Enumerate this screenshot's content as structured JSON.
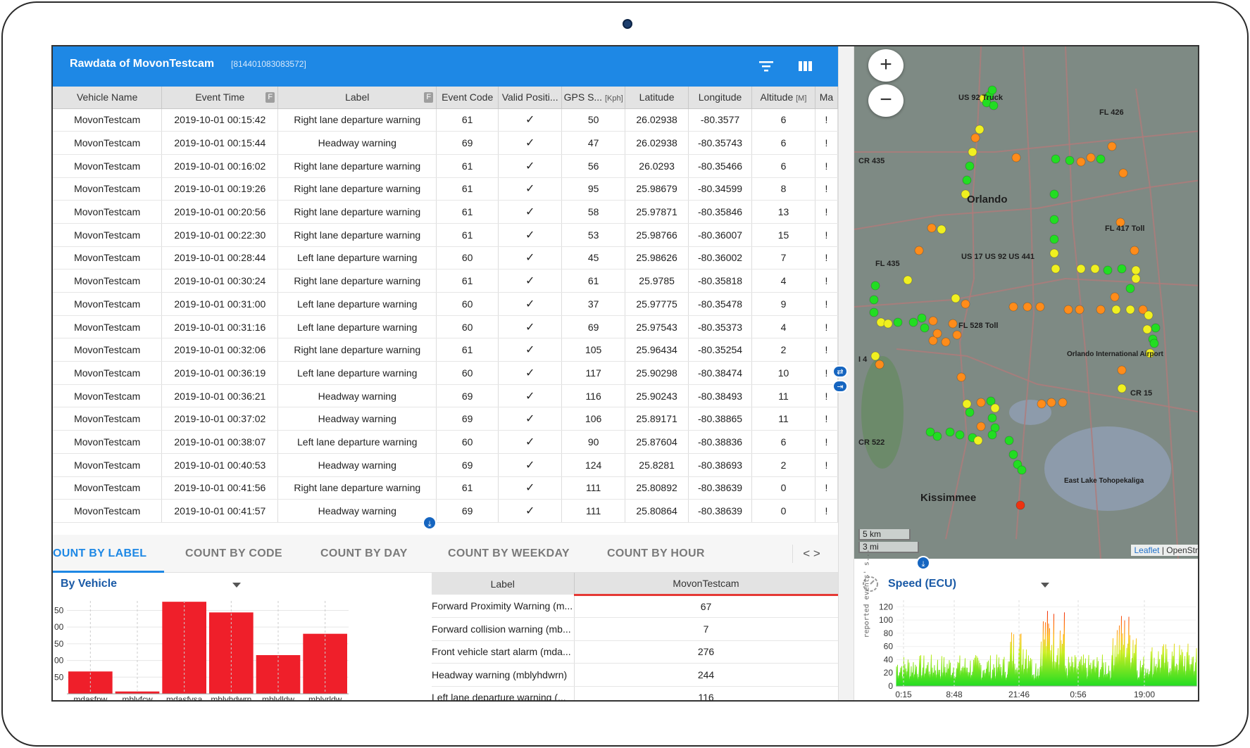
{
  "header": {
    "title": "Rawdata of MovonTestcam",
    "subtitle": "[814401083083572]"
  },
  "table": {
    "columns": [
      "Vehicle Name",
      "Event Time",
      "Label",
      "Event Code",
      "Valid Positi...",
      "GPS S...",
      "Latitude",
      "Longitude",
      "Altitude",
      "Ma"
    ],
    "units": {
      "gps": "[Kph]",
      "altitude": "[M]"
    },
    "filter_badge": "F",
    "rows": [
      [
        "MovonTestcam",
        "2019-10-01 00:15:42",
        "Right lane departure warning",
        "61",
        "✓",
        "50",
        "26.02938",
        "-80.3577",
        "6",
        "!"
      ],
      [
        "MovonTestcam",
        "2019-10-01 00:15:44",
        "Headway warning",
        "69",
        "✓",
        "47",
        "26.02938",
        "-80.35743",
        "6",
        "!"
      ],
      [
        "MovonTestcam",
        "2019-10-01 00:16:02",
        "Right lane departure warning",
        "61",
        "✓",
        "56",
        "26.0293",
        "-80.35466",
        "6",
        "!"
      ],
      [
        "MovonTestcam",
        "2019-10-01 00:19:26",
        "Right lane departure warning",
        "61",
        "✓",
        "95",
        "25.98679",
        "-80.34599",
        "8",
        "!"
      ],
      [
        "MovonTestcam",
        "2019-10-01 00:20:56",
        "Right lane departure warning",
        "61",
        "✓",
        "58",
        "25.97871",
        "-80.35846",
        "13",
        "!"
      ],
      [
        "MovonTestcam",
        "2019-10-01 00:22:30",
        "Right lane departure warning",
        "61",
        "✓",
        "53",
        "25.98766",
        "-80.36007",
        "15",
        "!"
      ],
      [
        "MovonTestcam",
        "2019-10-01 00:28:44",
        "Left lane departure warning",
        "60",
        "✓",
        "45",
        "25.98626",
        "-80.36002",
        "7",
        "!"
      ],
      [
        "MovonTestcam",
        "2019-10-01 00:30:24",
        "Right lane departure warning",
        "61",
        "✓",
        "61",
        "25.9785",
        "-80.35818",
        "4",
        "!"
      ],
      [
        "MovonTestcam",
        "2019-10-01 00:31:00",
        "Left lane departure warning",
        "60",
        "✓",
        "37",
        "25.97775",
        "-80.35478",
        "9",
        "!"
      ],
      [
        "MovonTestcam",
        "2019-10-01 00:31:16",
        "Left lane departure warning",
        "60",
        "✓",
        "69",
        "25.97543",
        "-80.35373",
        "4",
        "!"
      ],
      [
        "MovonTestcam",
        "2019-10-01 00:32:06",
        "Right lane departure warning",
        "61",
        "✓",
        "105",
        "25.96434",
        "-80.35254",
        "2",
        "!"
      ],
      [
        "MovonTestcam",
        "2019-10-01 00:36:19",
        "Left lane departure warning",
        "60",
        "✓",
        "117",
        "25.90298",
        "-80.38474",
        "10",
        "!"
      ],
      [
        "MovonTestcam",
        "2019-10-01 00:36:21",
        "Headway warning",
        "69",
        "✓",
        "116",
        "25.90243",
        "-80.38493",
        "11",
        "!"
      ],
      [
        "MovonTestcam",
        "2019-10-01 00:37:02",
        "Headway warning",
        "69",
        "✓",
        "106",
        "25.89171",
        "-80.38865",
        "11",
        "!"
      ],
      [
        "MovonTestcam",
        "2019-10-01 00:38:07",
        "Left lane departure warning",
        "60",
        "✓",
        "90",
        "25.87604",
        "-80.38836",
        "6",
        "!"
      ],
      [
        "MovonTestcam",
        "2019-10-01 00:40:53",
        "Headway warning",
        "69",
        "✓",
        "124",
        "25.8281",
        "-80.38693",
        "2",
        "!"
      ],
      [
        "MovonTestcam",
        "2019-10-01 00:41:56",
        "Right lane departure warning",
        "61",
        "✓",
        "111",
        "25.80892",
        "-80.38639",
        "0",
        "!"
      ],
      [
        "MovonTestcam",
        "2019-10-01 00:41:57",
        "Headway warning",
        "69",
        "✓",
        "111",
        "25.80864",
        "-80.38639",
        "0",
        "!"
      ]
    ]
  },
  "tabs": [
    "OUNT BY LABEL",
    "COUNT BY CODE",
    "COUNT BY DAY",
    "COUNT BY WEEKDAY",
    "COUNT BY HOUR"
  ],
  "tab_nav": "< >",
  "by_vehicle": {
    "title": "By Vehicle"
  },
  "counts_table": {
    "headers": [
      "Label",
      "MovonTestcam"
    ],
    "rows": [
      [
        "Forward Proximity Warning (m...",
        "67"
      ],
      [
        "Forward collision warning (mb...",
        "7"
      ],
      [
        "Front vehicle start alarm (mda...",
        "276"
      ],
      [
        "Headway warning (mblyhdwrn)",
        "244"
      ],
      [
        "Left lane departure warning (...",
        "116"
      ]
    ]
  },
  "map": {
    "zoom_in": "+",
    "zoom_out": "−",
    "scale_km": "5 km",
    "scale_mi": "3 mi",
    "attribution_link": "Leaflet",
    "attribution_rest": " | OpenStr",
    "labels": [
      {
        "text": "Orlando"
      },
      {
        "text": "Kissimmee"
      },
      {
        "text": "FL 417 Toll"
      },
      {
        "text": "US 17 US 92 US 441"
      },
      {
        "text": "FL 435"
      },
      {
        "text": "CR 15"
      },
      {
        "text": "FL 426"
      },
      {
        "text": "US 92 Truck"
      },
      {
        "text": "FL 528 Toll"
      },
      {
        "text": "I 4"
      },
      {
        "text": "Orlando International Airport"
      },
      {
        "text": "East Lake Tohopekaliga"
      },
      {
        "text": "CR 522"
      },
      {
        "text": "CR 435"
      }
    ],
    "colors": {
      "green": "#22dd22",
      "yellow": "#f0f020",
      "orange": "#ff8c1a",
      "red": "#ee3311"
    }
  },
  "speed": {
    "title": "Speed (ECU)",
    "ylabel": "reported events' s..."
  },
  "chart_data": [
    {
      "type": "bar",
      "title": "By Vehicle",
      "categories": [
        "mdasfpw",
        "mblyfcw",
        "mdasfvsa",
        "mblyhdwrn",
        "mblylldw",
        "mblyrldw"
      ],
      "values": [
        67,
        7,
        276,
        244,
        116,
        180
      ],
      "ylim": [
        0,
        270
      ],
      "yticks": [
        "50",
        "00",
        "50",
        "00",
        "50"
      ],
      "colors": [
        "#ef1f2a"
      ]
    },
    {
      "type": "area",
      "title": "Speed (ECU)",
      "xlabels": [
        "0:15",
        "8:48",
        "21:46",
        "0:56",
        "19:00"
      ],
      "yticks": [
        0,
        20,
        40,
        60,
        80,
        100,
        120
      ],
      "ylim": [
        0,
        130
      ]
    }
  ]
}
